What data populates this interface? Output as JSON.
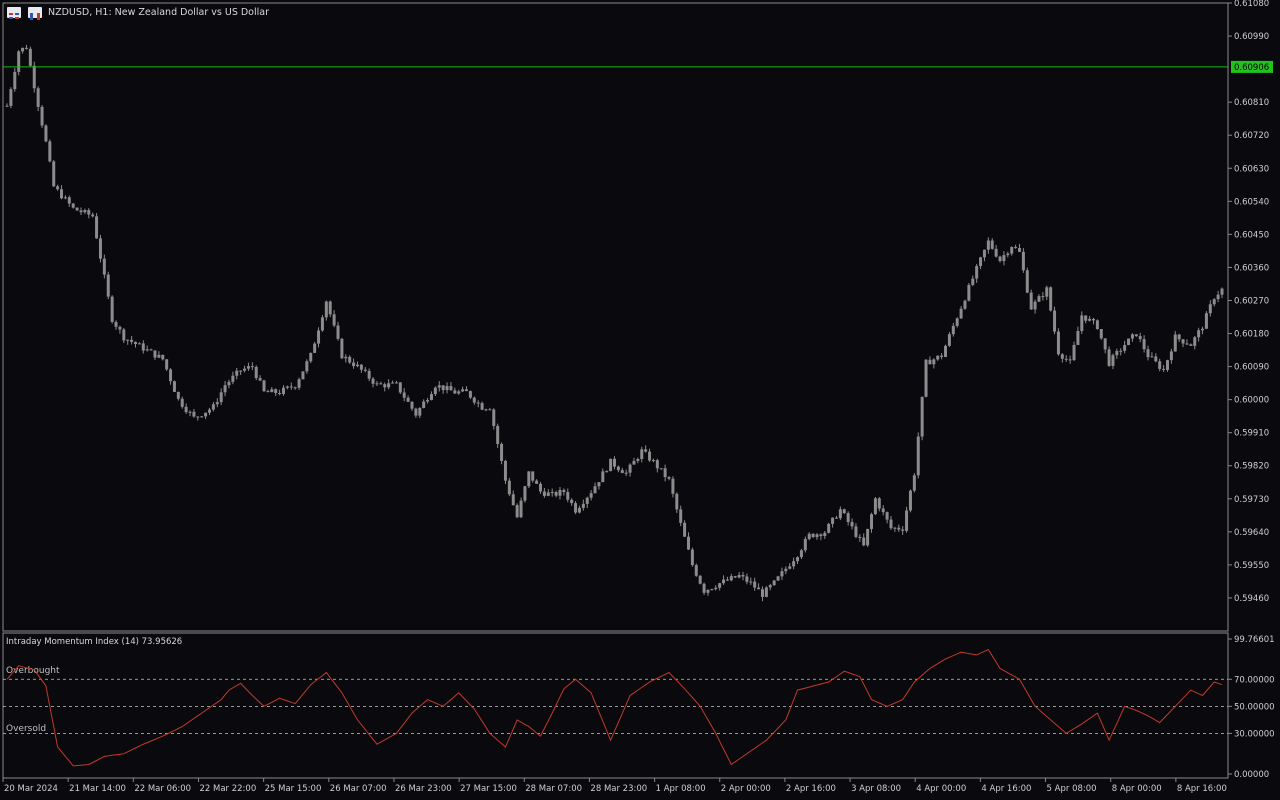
{
  "header": {
    "symbol_text": "NZDUSD, H1:  New Zealand Dollar vs US Dollar",
    "icons": [
      "chart-menu-icon",
      "trade-panel-icon"
    ]
  },
  "colors": {
    "background": "#0a0a0e",
    "candle": "#8c8c8c",
    "price_line": "#19b619",
    "price_tag": "#22c21e",
    "indicator_line": "#c0392b",
    "level_line": "#c8c8c8"
  },
  "current_price": {
    "value": 0.60906,
    "label": "0.60906"
  },
  "chart_data": [
    {
      "type": "candlestick",
      "ylim": [
        0.5937,
        0.6108
      ],
      "y_ticks": [
        "0.61080",
        "0.60990",
        "0.60810",
        "0.60720",
        "0.60630",
        "0.60540",
        "0.60450",
        "0.60360",
        "0.60270",
        "0.60180",
        "0.60090",
        "0.60000",
        "0.59910",
        "0.59820",
        "0.59730",
        "0.59640",
        "0.59550",
        "0.59460"
      ],
      "x_labels": [
        "20 Mar 2024",
        "21 Mar 14:00",
        "22 Mar 06:00",
        "22 Mar 22:00",
        "25 Mar 15:00",
        "26 Mar 07:00",
        "26 Mar 23:00",
        "27 Mar 15:00",
        "28 Mar 07:00",
        "28 Mar 23:00",
        "1 Apr 08:00",
        "2 Apr 00:00",
        "2 Apr 16:00",
        "3 Apr 08:00",
        "4 Apr 00:00",
        "4 Apr 16:00",
        "5 Apr 08:00",
        "8 Apr 00:00",
        "8 Apr 16:00"
      ],
      "close_path": [
        [
          0,
          0.608
        ],
        [
          3,
          0.6095
        ],
        [
          5,
          0.6096
        ],
        [
          10,
          0.607
        ],
        [
          12,
          0.6058
        ],
        [
          17,
          0.6052
        ],
        [
          22,
          0.605
        ],
        [
          27,
          0.6022
        ],
        [
          30,
          0.6017
        ],
        [
          35,
          0.6014
        ],
        [
          40,
          0.6011
        ],
        [
          44,
          0.6
        ],
        [
          48,
          0.5995
        ],
        [
          53,
          0.5998
        ],
        [
          56,
          0.6004
        ],
        [
          60,
          0.6008
        ],
        [
          63,
          0.6009
        ],
        [
          66,
          0.6002
        ],
        [
          70,
          0.6002
        ],
        [
          74,
          0.6004
        ],
        [
          78,
          0.6012
        ],
        [
          82,
          0.6027
        ],
        [
          86,
          0.6012
        ],
        [
          90,
          0.6009
        ],
        [
          95,
          0.6004
        ],
        [
          100,
          0.6004
        ],
        [
          105,
          0.5996
        ],
        [
          110,
          0.6004
        ],
        [
          115,
          0.6002
        ],
        [
          118,
          0.6002
        ],
        [
          122,
          0.5998
        ],
        [
          124,
          0.5998
        ],
        [
          128,
          0.5978
        ],
        [
          131,
          0.5968
        ],
        [
          134,
          0.598
        ],
        [
          137,
          0.5975
        ],
        [
          140,
          0.5974
        ],
        [
          143,
          0.5975
        ],
        [
          146,
          0.597
        ],
        [
          150,
          0.5975
        ],
        [
          155,
          0.5983
        ],
        [
          159,
          0.598
        ],
        [
          163,
          0.5986
        ],
        [
          166,
          0.5983
        ],
        [
          170,
          0.5978
        ],
        [
          173,
          0.5966
        ],
        [
          176,
          0.5955
        ],
        [
          179,
          0.5948
        ],
        [
          183,
          0.595
        ],
        [
          188,
          0.5952
        ],
        [
          191,
          0.595
        ],
        [
          194,
          0.5947
        ],
        [
          197,
          0.595
        ],
        [
          200,
          0.5954
        ],
        [
          203,
          0.5958
        ],
        [
          206,
          0.5963
        ],
        [
          210,
          0.5964
        ],
        [
          214,
          0.597
        ],
        [
          217,
          0.5965
        ],
        [
          220,
          0.596
        ],
        [
          223,
          0.5973
        ],
        [
          227,
          0.5965
        ],
        [
          230,
          0.5965
        ],
        [
          233,
          0.598
        ],
        [
          236,
          0.601
        ],
        [
          240,
          0.6012
        ],
        [
          243,
          0.602
        ],
        [
          248,
          0.6033
        ],
        [
          252,
          0.6043
        ],
        [
          255,
          0.6038
        ],
        [
          258,
          0.6042
        ],
        [
          260,
          0.604
        ],
        [
          263,
          0.6025
        ],
        [
          267,
          0.603
        ],
        [
          270,
          0.6013
        ],
        [
          273,
          0.601
        ],
        [
          276,
          0.6023
        ],
        [
          280,
          0.602
        ],
        [
          283,
          0.601
        ],
        [
          287,
          0.6015
        ],
        [
          290,
          0.6018
        ],
        [
          293,
          0.6012
        ],
        [
          297,
          0.6008
        ],
        [
          300,
          0.6017
        ],
        [
          304,
          0.6015
        ],
        [
          307,
          0.602
        ],
        [
          310,
          0.6028
        ],
        [
          312,
          0.603
        ]
      ],
      "n_candles": 313
    },
    {
      "type": "line",
      "title": "Intraday Momentum Index (14) 73.95626",
      "ylim": [
        0,
        99.76601
      ],
      "y_ticks": [
        "99.76601",
        "70.00000",
        "50.00000",
        "30.00000",
        "0.00000"
      ],
      "levels": [
        {
          "value": 70,
          "label": "Overbought"
        },
        {
          "value": 50,
          "label": ""
        },
        {
          "value": 30,
          "label": "Oversold"
        }
      ],
      "series_path": [
        [
          0,
          70
        ],
        [
          3,
          80
        ],
        [
          7,
          77
        ],
        [
          10,
          65
        ],
        [
          13,
          20
        ],
        [
          17,
          6
        ],
        [
          21,
          7
        ],
        [
          25,
          13
        ],
        [
          30,
          15
        ],
        [
          35,
          22
        ],
        [
          40,
          28
        ],
        [
          45,
          35
        ],
        [
          50,
          45
        ],
        [
          55,
          55
        ],
        [
          57,
          62
        ],
        [
          60,
          67
        ],
        [
          63,
          58
        ],
        [
          66,
          50
        ],
        [
          70,
          56
        ],
        [
          74,
          52
        ],
        [
          78,
          66
        ],
        [
          82,
          75
        ],
        [
          86,
          60
        ],
        [
          90,
          40
        ],
        [
          95,
          22
        ],
        [
          100,
          30
        ],
        [
          104,
          45
        ],
        [
          108,
          55
        ],
        [
          112,
          50
        ],
        [
          116,
          60
        ],
        [
          120,
          48
        ],
        [
          124,
          30
        ],
        [
          128,
          20
        ],
        [
          131,
          40
        ],
        [
          134,
          35
        ],
        [
          137,
          28
        ],
        [
          140,
          45
        ],
        [
          143,
          63
        ],
        [
          146,
          70
        ],
        [
          150,
          60
        ],
        [
          155,
          25
        ],
        [
          160,
          58
        ],
        [
          165,
          68
        ],
        [
          170,
          75
        ],
        [
          174,
          63
        ],
        [
          178,
          50
        ],
        [
          182,
          30
        ],
        [
          186,
          7
        ],
        [
          190,
          15
        ],
        [
          195,
          25
        ],
        [
          200,
          40
        ],
        [
          203,
          62
        ],
        [
          207,
          65
        ],
        [
          211,
          68
        ],
        [
          215,
          76
        ],
        [
          219,
          72
        ],
        [
          222,
          55
        ],
        [
          226,
          50
        ],
        [
          230,
          55
        ],
        [
          233,
          68
        ],
        [
          237,
          78
        ],
        [
          241,
          85
        ],
        [
          245,
          90
        ],
        [
          249,
          88
        ],
        [
          252,
          92
        ],
        [
          255,
          78
        ],
        [
          260,
          70
        ],
        [
          264,
          50
        ],
        [
          268,
          40
        ],
        [
          272,
          30
        ],
        [
          276,
          37
        ],
        [
          280,
          45
        ],
        [
          283,
          25
        ],
        [
          287,
          50
        ],
        [
          290,
          47
        ],
        [
          293,
          43
        ],
        [
          296,
          38
        ],
        [
          300,
          50
        ],
        [
          304,
          62
        ],
        [
          307,
          58
        ],
        [
          310,
          68
        ],
        [
          312,
          66
        ]
      ]
    }
  ]
}
